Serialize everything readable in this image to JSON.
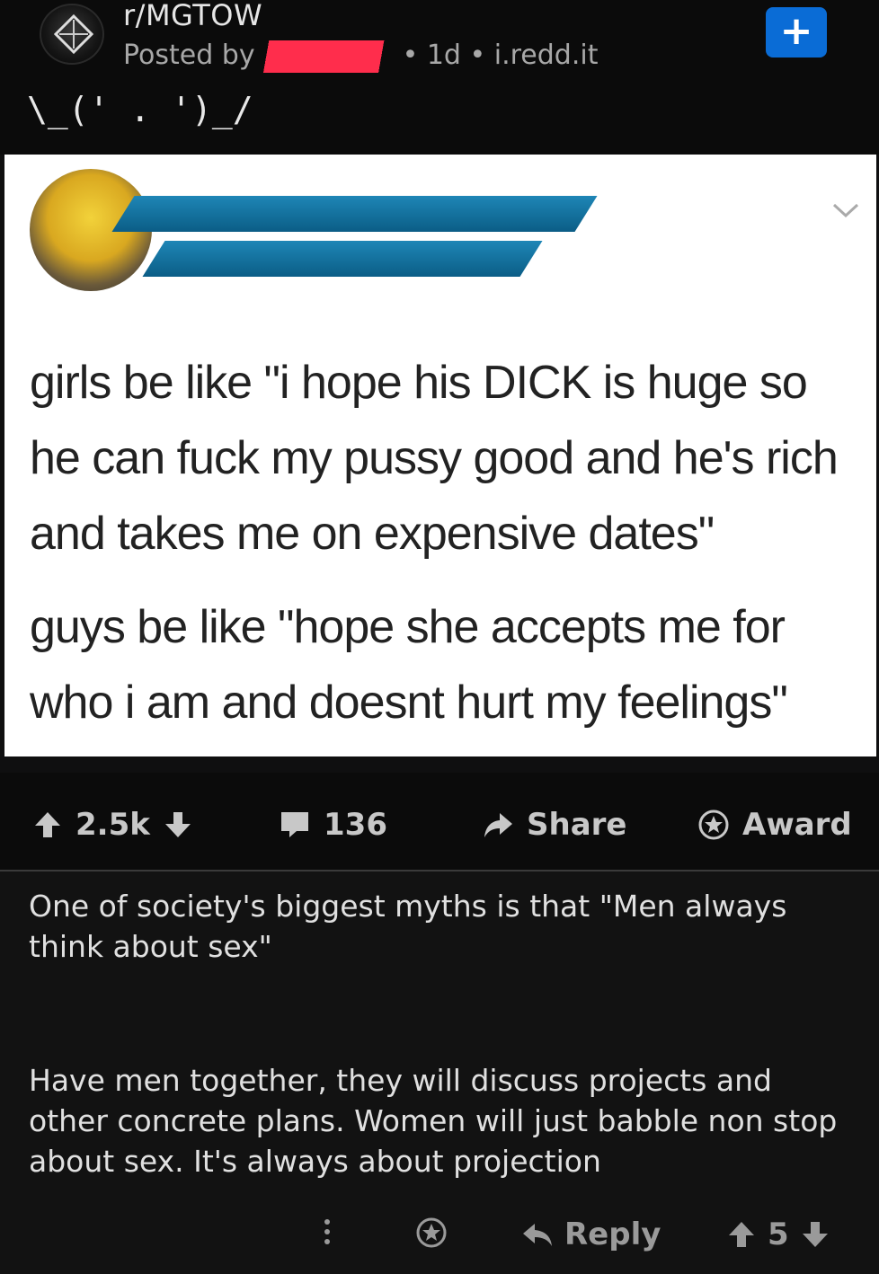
{
  "post": {
    "subreddit": "r/MGTOW",
    "posted_by_label": "Posted by",
    "meta": "• 1d • i.redd.it",
    "title": "\\_(' . ')_/",
    "join_label": "+"
  },
  "tweet": {
    "line_group_1": "girls be like \"i hope his DICK is huge so he can fuck my pussy good and he's rich and takes me on expensive dates\"",
    "line_group_2": "guys be like \"hope she accepts me for who i am and doesnt hurt my feelings\""
  },
  "actions": {
    "votes": "2.5k",
    "comments": "136",
    "share": "Share",
    "award": "Award"
  },
  "comment": {
    "para1": "One of society's biggest myths is that \"Men always think about sex\"",
    "para2": "Have men together, they will discuss projects and other concrete plans.  Women will just babble non stop about sex.  It's always about projection",
    "reply": "Reply",
    "votes": "5"
  },
  "colors": {
    "join_button": "#0a6cd6",
    "redaction_red": "#ff2d4c",
    "redaction_blue": "#1e86b6"
  }
}
